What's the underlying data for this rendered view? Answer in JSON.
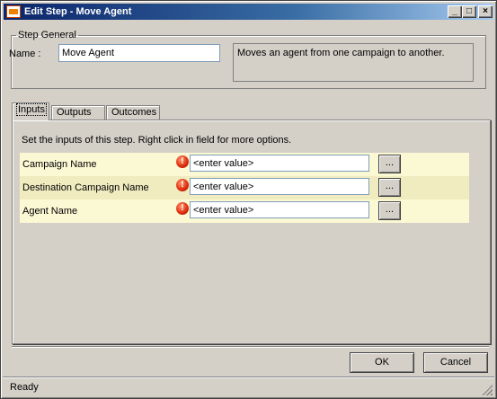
{
  "window": {
    "title": "Edit Step - Move Agent",
    "controls": {
      "minimize": "_",
      "maximize": "□",
      "close": "×"
    }
  },
  "step_general": {
    "legend": "Step General",
    "name_label": "Name :",
    "name_value": "Move Agent",
    "description": "Moves an agent from one campaign to another."
  },
  "tabs": [
    {
      "label": "Inputs",
      "active": true
    },
    {
      "label": "Outputs",
      "active": false
    },
    {
      "label": "Outcomes",
      "active": false
    }
  ],
  "inputs_panel": {
    "hint": "Set the inputs of this step.  Right click in field for more options.",
    "rows": [
      {
        "label": "Campaign Name",
        "value": "<enter value>",
        "button": "...",
        "icon": "error-icon"
      },
      {
        "label": "Destination Campaign Name",
        "value": "<enter value>",
        "button": "...",
        "icon": "error-icon"
      },
      {
        "label": "Agent Name",
        "value": "<enter value>",
        "button": "...",
        "icon": "error-icon"
      }
    ]
  },
  "buttons": {
    "ok": "OK",
    "cancel": "Cancel"
  },
  "status": {
    "text": "Ready"
  },
  "colors": {
    "row_light": "#fbf8d4",
    "row_dark": "#f0ecc0",
    "title_start": "#0a246a",
    "title_end": "#a6caf0"
  }
}
